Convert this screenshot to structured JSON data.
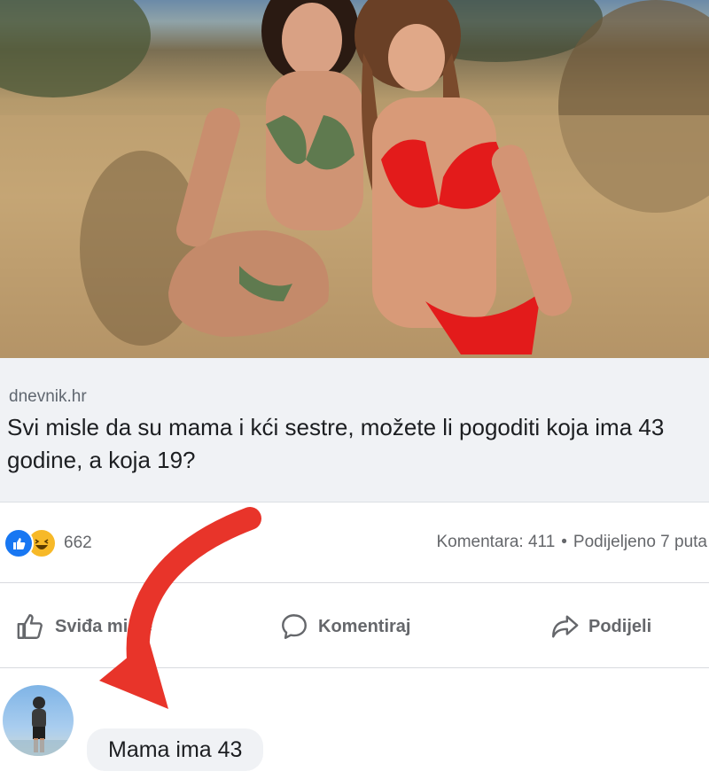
{
  "post": {
    "domain": "dnevnik.hr",
    "headline": "Svi misle da su mama i kći sestre, možete li pogoditi koja ima 43 godine, a koja 19?"
  },
  "stats": {
    "reaction_count": "662",
    "comments": "Komentara: 411",
    "separator": "•",
    "shares": "Podijeljeno 7 puta"
  },
  "actions": {
    "like": "Sviđa mi se",
    "comment": "Komentiraj",
    "share": "Podijeli"
  },
  "comment": {
    "text": "Mama ima 43"
  },
  "icons": [
    "like-reaction-icon",
    "haha-reaction-icon",
    "thumbs-up-icon",
    "speech-bubble-icon",
    "share-arrow-icon",
    "red-arrow-annotation"
  ],
  "colors": {
    "facebook_blue": "#1877f2",
    "haha_yellow": "#f7b928",
    "annotation_red": "#e8342a",
    "card_bg": "#f0f2f5"
  }
}
